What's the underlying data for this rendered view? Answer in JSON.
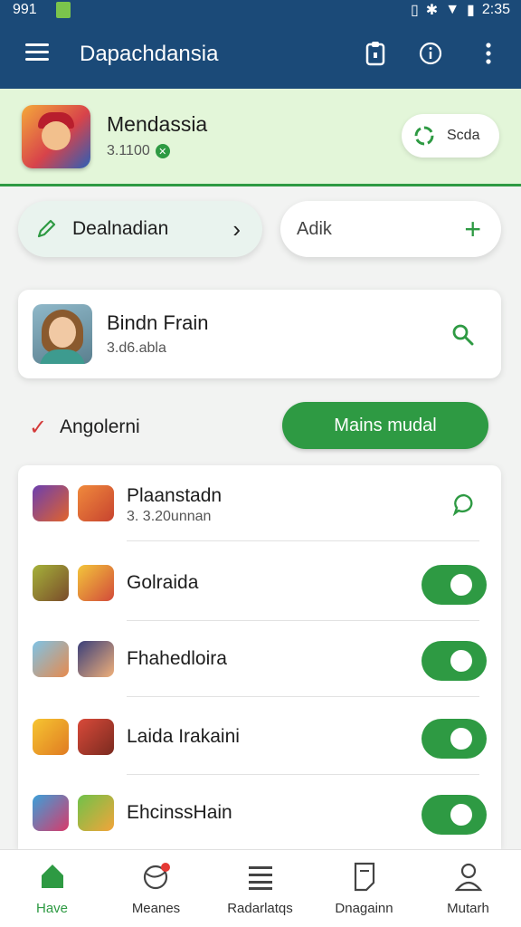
{
  "status": {
    "time": "991",
    "clock": "2:35"
  },
  "appbar": {
    "title": "Dapachdansia",
    "icons": [
      "menu-icon",
      "clipboard-icon",
      "info-icon",
      "more-vert-icon"
    ]
  },
  "hero": {
    "name": "Mendassia",
    "count": "3.1100",
    "sync_label": "Scda"
  },
  "actions": {
    "left_label": "Dealnadian",
    "right_label": "Adik"
  },
  "contact": {
    "name": "Bindn Frain",
    "sub": "3.d6.abla"
  },
  "angle": {
    "label": "Angolerni",
    "button": "Mains mudal"
  },
  "list": [
    {
      "title": "Plaanstadn",
      "sub": "3. 3.20unnan",
      "control": "bubble"
    },
    {
      "title": "Golraida",
      "sub": "",
      "control": "toggle"
    },
    {
      "title": "Fhahedloira",
      "sub": "",
      "control": "toggle"
    },
    {
      "title": "Laida Irakaini",
      "sub": "",
      "control": "toggle"
    },
    {
      "title": "EhcinssHain",
      "sub": "",
      "control": "toggle"
    }
  ],
  "nav": [
    {
      "label": "Have",
      "icon": "home-icon",
      "active": true
    },
    {
      "label": "Meanes",
      "icon": "globe-icon",
      "active": false
    },
    {
      "label": "Radarlatqs",
      "icon": "list-icon",
      "active": false
    },
    {
      "label": "Dnagainn",
      "icon": "document-icon",
      "active": false
    },
    {
      "label": "Mutarh",
      "icon": "person-icon",
      "active": false
    }
  ],
  "colors": {
    "primary": "#1b4a78",
    "accent": "#2e9a43",
    "hero_bg": "#e3f6d9"
  }
}
